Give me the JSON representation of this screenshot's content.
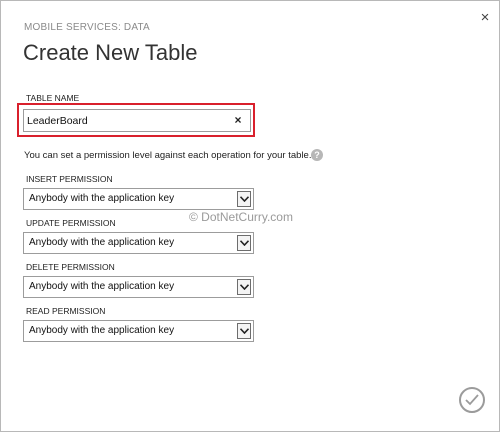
{
  "dialog": {
    "close_glyph": "×",
    "subtitle": "MOBILE SERVICES: DATA",
    "title": "Create New Table"
  },
  "table_name": {
    "label": "TABLE NAME",
    "value": "LeaderBoard",
    "clear_glyph": "×"
  },
  "help": {
    "text": "You can set a permission level against each operation for your table.",
    "icon_glyph": "?"
  },
  "permissions": [
    {
      "label": "INSERT PERMISSION",
      "value": "Anybody with the application key"
    },
    {
      "label": "UPDATE PERMISSION",
      "value": "Anybody with the application key"
    },
    {
      "label": "DELETE PERMISSION",
      "value": "Anybody with the application key"
    },
    {
      "label": "READ PERMISSION",
      "value": "Anybody with the application key"
    }
  ],
  "watermark": "© DotNetCurry.com",
  "colors": {
    "highlight_border": "#d9202c",
    "subtitle": "#8a8a8a",
    "ok_button": "#9b9b9b"
  },
  "icons": {
    "close": "close-icon",
    "clear": "clear-icon",
    "help": "help-icon",
    "dropdown": "chevron-down-icon",
    "ok": "checkmark-icon"
  }
}
